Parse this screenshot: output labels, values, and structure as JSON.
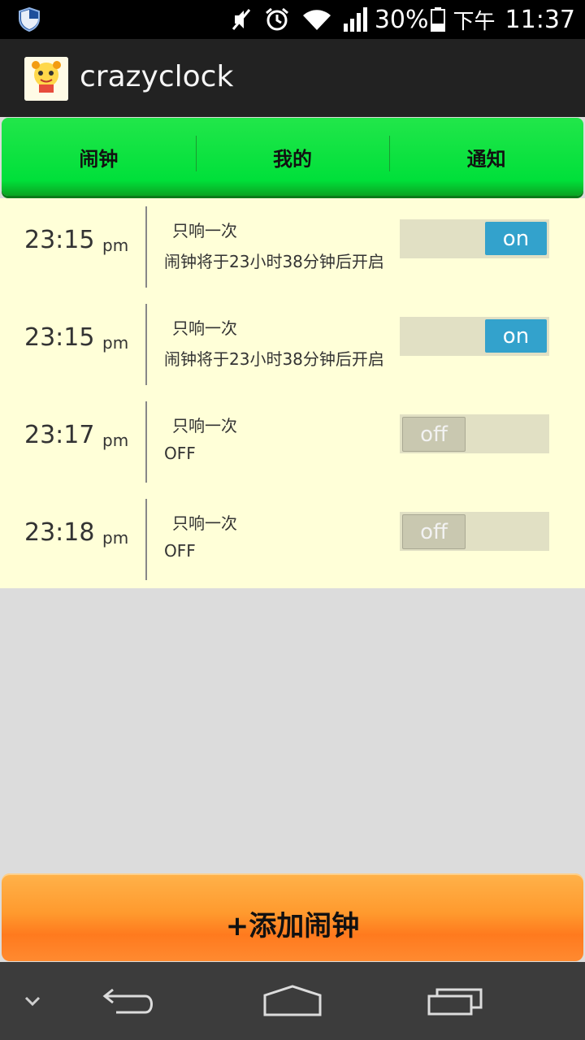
{
  "status_bar": {
    "battery": "30%",
    "ampm": "下午",
    "time": "11:37",
    "icons": [
      "security-shield-icon",
      "mute-icon",
      "alarm-icon",
      "wifi-icon",
      "signal-icon",
      "battery-icon"
    ]
  },
  "action_bar": {
    "title": "crazyclock",
    "icon_text": "crazy clock"
  },
  "tabs": [
    {
      "label": "闹钟"
    },
    {
      "label": "我的"
    },
    {
      "label": "通知"
    }
  ],
  "alarms": [
    {
      "time": "23:15",
      "ampm": "pm",
      "repeat": "只响一次",
      "status": "闹钟将于23小时38分钟后开启",
      "switch": "on"
    },
    {
      "time": "23:15",
      "ampm": "pm",
      "repeat": "只响一次",
      "status": "闹钟将于23小时38分钟后开启",
      "switch": "on"
    },
    {
      "time": "23:17",
      "ampm": "pm",
      "repeat": "只响一次",
      "status": "OFF",
      "switch": "off"
    },
    {
      "time": "23:18",
      "ampm": "pm",
      "repeat": "只响一次",
      "status": "OFF",
      "switch": "off"
    }
  ],
  "add_button": {
    "label": "+添加闹钟"
  },
  "colors": {
    "tab_green": "#00e03a",
    "list_bg": "#ffffd8",
    "switch_on": "#33a2cc",
    "add_orange": "#ff8a30"
  }
}
